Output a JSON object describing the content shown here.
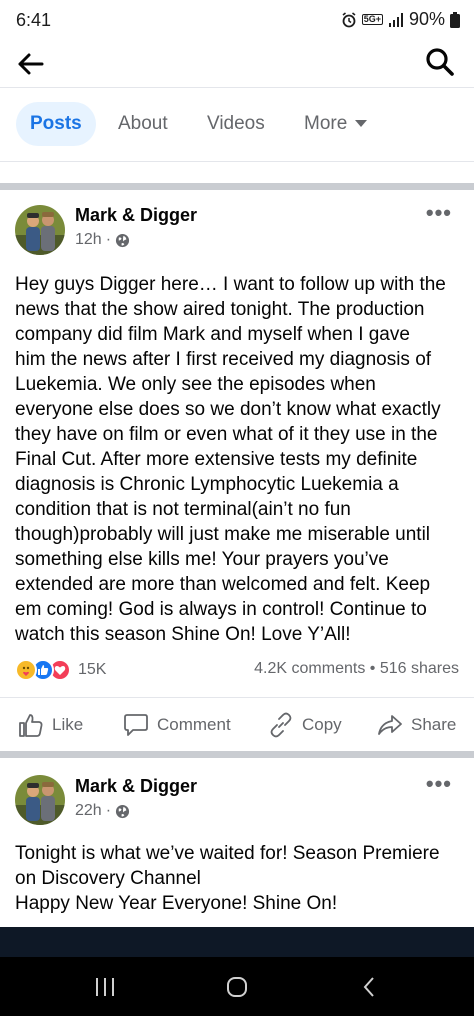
{
  "status_bar": {
    "time": "6:41",
    "network": "5G+",
    "battery": "90%"
  },
  "tabs": [
    {
      "label": "Posts",
      "active": true
    },
    {
      "label": "About",
      "active": false
    },
    {
      "label": "Videos",
      "active": false
    },
    {
      "label": "More",
      "active": false
    }
  ],
  "posts": [
    {
      "author": "Mark & Digger",
      "time": "12h",
      "privacy_icon": "globe-icon",
      "lines": [
        "Hey guys Digger here… I want to follow up with the",
        "news that the show aired tonight. The production",
        "company did film Mark and myself when I gave",
        "him the news after I first received my diagnosis of",
        "Luekemia. We only see the episodes when",
        "everyone else does so we don’t know what exactly",
        "they have on film or even what of it they use in the",
        "Final Cut. After more extensive tests my definite",
        "diagnosis is Chronic Lymphocytic Luekemia a",
        "condition that is not terminal(ain’t no fun",
        "though)probably will just make me miserable until",
        "something else kills me! Your prayers you’ve",
        "extended are more than welcomed and felt. Keep",
        "em coming! God is always in control! Continue to",
        "watch this season Shine On! Love Y’All!"
      ],
      "reaction_count": "15K",
      "comments": "4.2K comments",
      "shares": "516 shares",
      "stats_separator": "•",
      "actions": {
        "like": "Like",
        "comment": "Comment",
        "copy": "Copy",
        "share": "Share"
      }
    },
    {
      "author": "Mark & Digger",
      "time": "22h",
      "privacy_icon": "globe-icon",
      "lines": [
        "Tonight is what we’ve waited for! Season Premiere",
        "on Discovery Channel",
        "Happy New Year Everyone! Shine On!"
      ]
    }
  ],
  "colors": {
    "accent": "#1b74e4",
    "secondary_text": "#65676b",
    "divider": "#c9ccd1",
    "like_blue": "#1877f2",
    "love_red": "#f33e58",
    "care_yellow": "#f7b928"
  }
}
